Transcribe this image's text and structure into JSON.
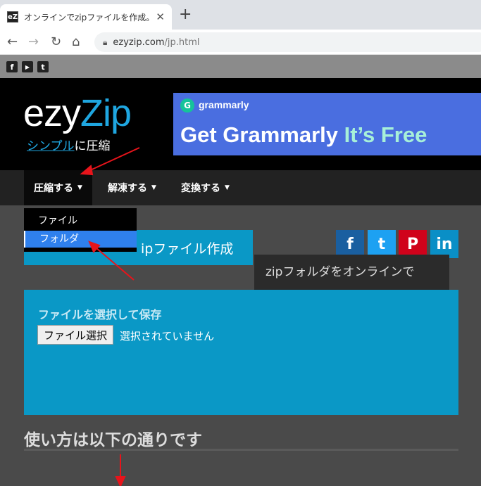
{
  "browser": {
    "tab_title": "オンラインでzipファイルを作成。高速、",
    "tab_favicon": "eZ",
    "close_glyph": "✕",
    "new_tab_glyph": "+",
    "url_domain": "ezyzip.com",
    "url_path": "/jp.html"
  },
  "social_strip": {
    "icons": [
      "f",
      "▶",
      "t"
    ]
  },
  "header": {
    "logo_prefix": "ezy",
    "logo_zip": "Zip",
    "tagline_link": "シンプル",
    "tagline_rest": "に圧縮"
  },
  "ad": {
    "brand": "grammarly",
    "logo_glyph": "G",
    "headline_main": "Get Grammarly ",
    "headline_free": "It’s Free"
  },
  "nav": {
    "items": [
      {
        "label": "圧縮する"
      },
      {
        "label": "解凍する"
      },
      {
        "label": "変換する"
      }
    ],
    "caret": "▼"
  },
  "dropdown": {
    "items": [
      {
        "label": "ファイル"
      },
      {
        "label": "フォルダ"
      }
    ]
  },
  "main": {
    "title": "ipファイル作成",
    "tooltip": "zipフォルダをオンラインで",
    "share": [
      {
        "glyph": "f",
        "color": "#1a5fa0"
      },
      {
        "glyph": "t",
        "color": "#1da1f2"
      },
      {
        "glyph": "P",
        "color": "#d0021b"
      },
      {
        "glyph": "in",
        "color": "#0a8fc6"
      }
    ],
    "upload_label": "ファイルを選択して保存",
    "file_button": "ファイル選択",
    "file_status": "選択されていません",
    "howto_heading": "使い方は以下の通りです"
  }
}
